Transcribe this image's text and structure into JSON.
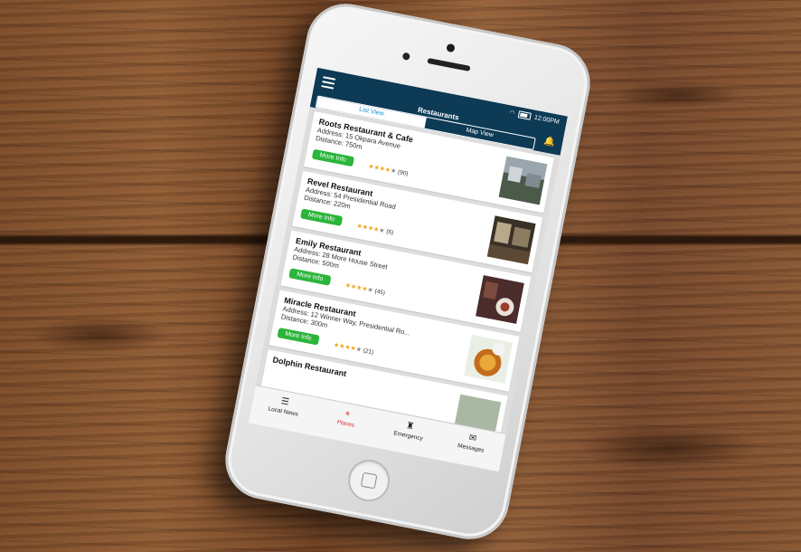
{
  "app": {
    "title": "Restaurants",
    "status_time": "12:00PM",
    "segments": [
      "List View",
      "Map View"
    ]
  },
  "restaurants": [
    {
      "name": "Roots Restaurant & Cafe",
      "address": "Address: 15 Okpara Avenue",
      "distance": "Distance: 750m",
      "rating": 4,
      "reviews": "(90)"
    },
    {
      "name": "Revel Restaurant",
      "address": "Address: 54 Presidential Road",
      "distance": "Distance: 220m",
      "rating": 4,
      "reviews": "(6)"
    },
    {
      "name": "Emily Restaurant",
      "address": "Address: 28 More House Street",
      "distance": "Distance: 500m",
      "rating": 4,
      "reviews": "(45)"
    },
    {
      "name": "Miracle Restaurant",
      "address": "Address: 12 Winner Way, Presidential Ro...",
      "distance": "Distance: 300m",
      "rating": 4,
      "reviews": "(21)"
    },
    {
      "name": "Dolphin Restaurant",
      "address": "",
      "distance": "",
      "rating": 0,
      "reviews": ""
    }
  ],
  "more_info_label": "More Info",
  "tabs": [
    {
      "label": "Local News",
      "icon": "list-icon"
    },
    {
      "label": "Places",
      "icon": "pin-icon"
    },
    {
      "label": "Emergency",
      "icon": "siren-icon"
    },
    {
      "label": "Messages",
      "icon": "mail-icon"
    }
  ],
  "colors": {
    "appbar": "#0d3a55",
    "accent": "#1b8fd8",
    "button": "#2bb53a",
    "active_tab": "#e52e2e",
    "star": "#f2a516"
  }
}
